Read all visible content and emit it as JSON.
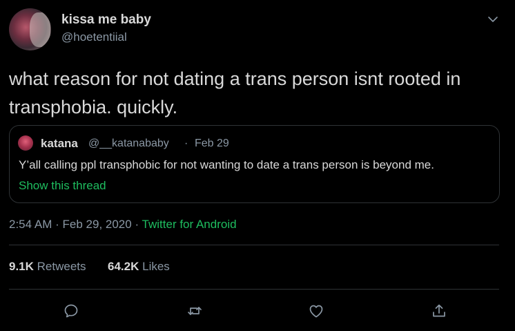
{
  "author": {
    "display_name": "kissa me baby",
    "handle": "@hoetentiial"
  },
  "tweet": {
    "text": "what reason for not dating a trans person isnt rooted in transphobia. quickly."
  },
  "quoted_tweet": {
    "name": "katana",
    "handle": "@__katanababy",
    "separator": "·",
    "date": "Feb 29",
    "text": "Y’all calling ppl transphobic for not wanting to date a trans person is beyond me.",
    "show_thread": "Show this thread"
  },
  "meta": {
    "time": "2:54 AM",
    "date": "Feb 29, 2020",
    "separator": "·",
    "source": "Twitter for Android"
  },
  "stats": {
    "retweets_count": "9.1K",
    "retweets_label": "Retweets",
    "likes_count": "64.2K",
    "likes_label": "Likes"
  },
  "icons": [
    "chevron-down-icon",
    "reply-icon",
    "retweet-icon",
    "like-icon",
    "share-icon"
  ],
  "colors": {
    "background": "#000000",
    "text": "#d9d9d9",
    "secondary": "#8b98a5",
    "accent": "#1ebd5f",
    "border": "#2f3336"
  }
}
